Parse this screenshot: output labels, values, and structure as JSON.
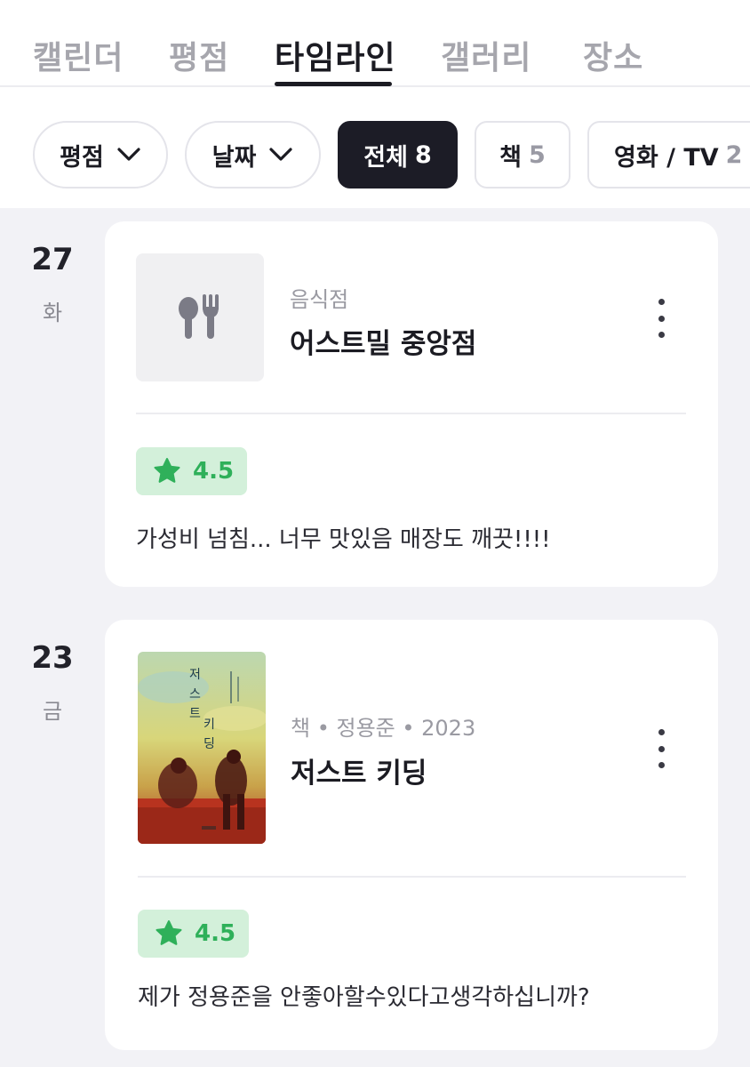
{
  "tabs": [
    "캘린더",
    "평점",
    "타임라인",
    "갤러리",
    "장소"
  ],
  "filters": {
    "sort_rating": "평점",
    "sort_date": "날짜",
    "all": {
      "label": "전체",
      "count": "8"
    },
    "book": {
      "label": "책",
      "count": "5"
    },
    "movie_tv": {
      "label": "영화 / TV",
      "count": "2"
    }
  },
  "entries": [
    {
      "day": "27",
      "weekday": "화",
      "category": "음식점",
      "title": "어스트밀 중앙점",
      "rating": "4.5",
      "review": "가성비 넘침... 너무 맛있음 매장도 깨끗!!!!",
      "icon": "restaurant-icon"
    },
    {
      "day": "23",
      "weekday": "금",
      "category": "책 • 정용준 • 2023",
      "title": "저스트 키딩",
      "rating": "4.5",
      "review": "제가 정용준을 안좋아할수있다고생각하십니까?",
      "cover_title": "저스트 키딩"
    }
  ],
  "colors": {
    "rating_bg": "#d3f0da",
    "rating_fg": "#2fb05a",
    "selected_chip": "#1c1c26"
  }
}
